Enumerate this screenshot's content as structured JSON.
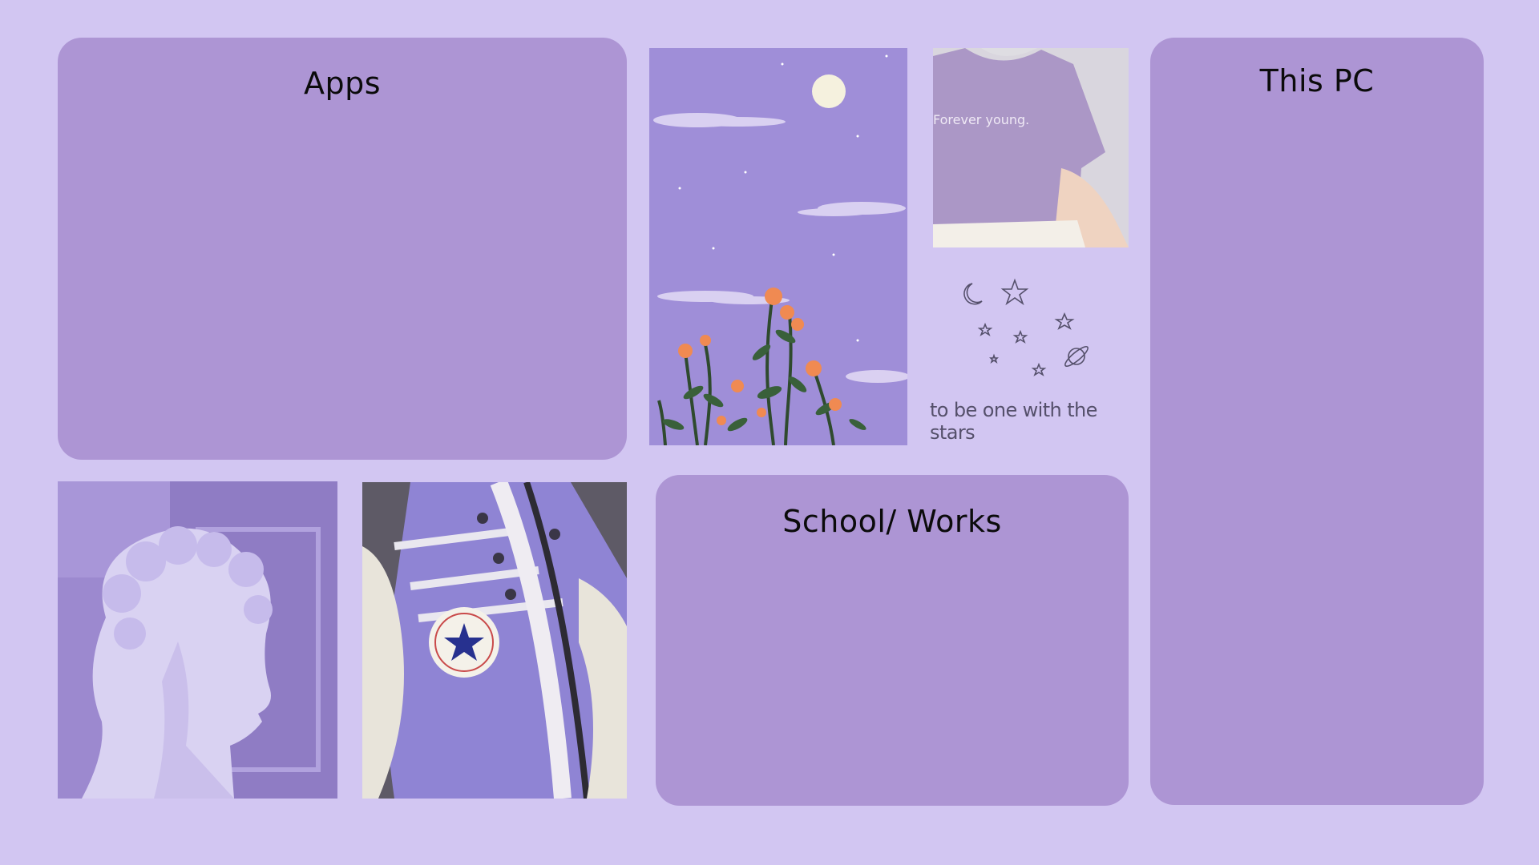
{
  "desktop": {
    "background_color": "#d2c6f2",
    "panel_color": "#ad95d4",
    "panels": {
      "apps": {
        "title": "Apps"
      },
      "this_pc": {
        "title": "This PC"
      },
      "school_works": {
        "title": "School/ Works"
      }
    },
    "images": {
      "tshirt": {
        "caption": "Forever young."
      },
      "stars_quote": {
        "text": "to be one with the stars"
      }
    }
  }
}
